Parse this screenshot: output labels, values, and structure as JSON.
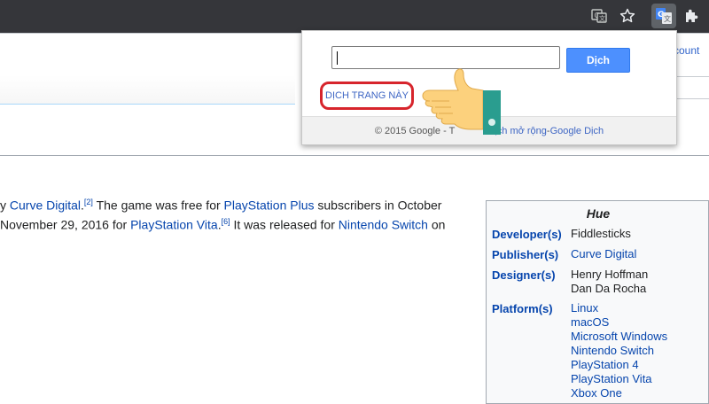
{
  "browser": {
    "icons": [
      "translate-page-icon",
      "bookmark-star-icon",
      "google-translate-extension-icon",
      "extensions-puzzle-icon"
    ]
  },
  "page": {
    "account_text": "count",
    "article": {
      "line1": {
        "t1": "y ",
        "link1": "Curve Digital",
        "t2": ".",
        "sup1": "[2]",
        "t3": " The game was free for ",
        "link2": "PlayStation Plus",
        "t4": " subscribers in October"
      },
      "line2": {
        "t1": " November 29, 2016 for ",
        "link1": "PlayStation Vita",
        "t2": ".",
        "sup1": "[6]",
        "t3": " It was released for ",
        "link2": "Nintendo Switch",
        "t4": " on"
      }
    },
    "infobox": {
      "title": "Hue",
      "rows": [
        {
          "label": "Developer(s)",
          "values": [
            "Fiddlesticks"
          ],
          "links": [
            false
          ]
        },
        {
          "label": "Publisher(s)",
          "values": [
            "Curve Digital"
          ],
          "links": [
            true
          ]
        },
        {
          "label": "Designer(s)",
          "values": [
            "Henry Hoffman",
            "Dan Da Rocha"
          ],
          "links": [
            false,
            false
          ]
        },
        {
          "label": "Platform(s)",
          "values": [
            "Linux",
            "macOS",
            "Microsoft Windows",
            "Nintendo Switch",
            "PlayStation 4",
            "PlayStation Vita",
            "Xbox One"
          ],
          "links": [
            true,
            true,
            true,
            true,
            true,
            true,
            true
          ]
        }
      ]
    }
  },
  "popup": {
    "input_value": "",
    "translate_button": "Dịch",
    "translate_page_link": "DỊCH TRANG NÀY",
    "footer": {
      "copyright": "© 2015 Google - T",
      "link1": "ịch mở rộng",
      "sep": " - ",
      "link2": "Google Dịch"
    }
  },
  "colors": {
    "toolbar": "#35363a",
    "link": "#0645ad",
    "button": "#4d90fe",
    "highlight_ring": "#d7252c"
  }
}
